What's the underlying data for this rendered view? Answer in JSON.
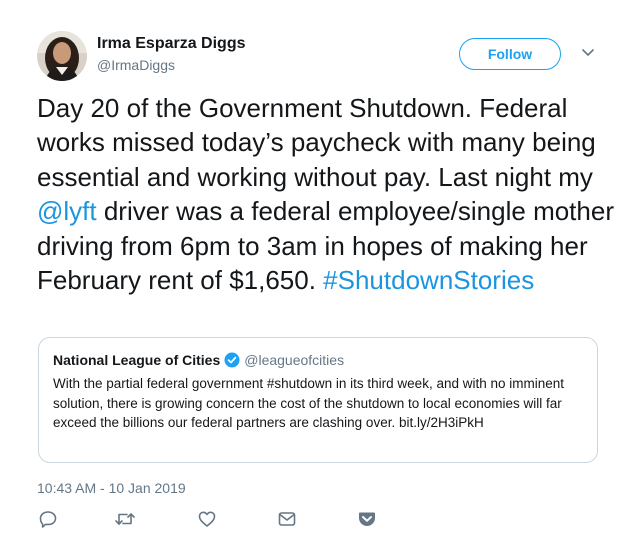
{
  "author": {
    "display_name": "Irma Esparza Diggs",
    "screen_name": "@IrmaDiggs"
  },
  "follow_button": {
    "label": "Follow"
  },
  "tweet": {
    "segments": [
      {
        "text": "Day 20 of the Government Shutdown. Federal works missed today’s paycheck with many being essential and working without pay. Last night my ",
        "type": "text"
      },
      {
        "text": "@lyft",
        "type": "mention"
      },
      {
        "text": " driver was a federal employee/single mother driving from 6pm to 3am in hopes of making her February rent of $1,650. ",
        "type": "text"
      },
      {
        "text": "#ShutdownStories",
        "type": "hashtag"
      }
    ]
  },
  "quote": {
    "name": "National League of Cities",
    "handle": "@leagueofcities",
    "text": "With the partial federal government #shutdown in its third week, and with no imminent solution, there is growing concern the cost of the shutdown to local economies will far exceed the billions our federal partners are clashing over. bit.ly/2H3iPkH"
  },
  "timestamp": "10:43 AM - 10 Jan 2019",
  "actions": [
    {
      "name": "reply-icon"
    },
    {
      "name": "retweet-icon"
    },
    {
      "name": "like-icon"
    },
    {
      "name": "direct-message-icon"
    },
    {
      "name": "pocket-icon"
    }
  ],
  "colors": {
    "link": "#1b95e0",
    "follow_accent": "#1da1f2",
    "secondary_text": "#657786",
    "card_border": "#ccd6dd",
    "icon": "#657786"
  }
}
